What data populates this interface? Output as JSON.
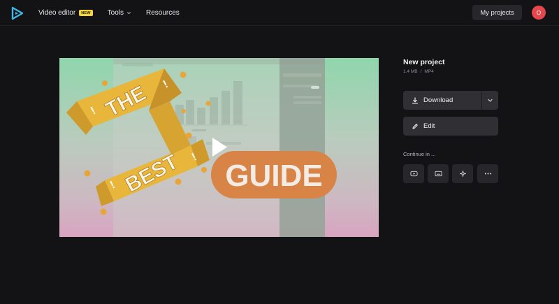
{
  "header": {
    "nav": {
      "video_editor": "Video editor",
      "badge": "NEW",
      "tools": "Tools",
      "resources": "Resources"
    },
    "my_projects": "My projects",
    "avatar_initial": "O"
  },
  "project": {
    "title": "New project",
    "size": "1.4 MB",
    "separator": "/",
    "format": "MP4"
  },
  "actions": {
    "download_label": "Download",
    "edit_label": "Edit",
    "continue_label": "Continue in ..."
  },
  "thumbnail": {
    "banner_words": [
      "THE",
      "BEST"
    ],
    "exclaims": [
      "!",
      "!",
      "!",
      "!"
    ],
    "guide": "GUIDE"
  },
  "icons": {
    "logo": "play-logo-icon",
    "download": "download-icon",
    "edit": "pencil-icon",
    "continue": [
      "youtube-icon",
      "subtitles-icon",
      "magic-sparkle-icon",
      "more-icon"
    ]
  },
  "colors": {
    "accent_avatar": "#e5474e",
    "badge": "#f5d33b",
    "logo": "#3fb7e8",
    "banner": "#e8b63a",
    "guide_pill": "#d98447"
  }
}
